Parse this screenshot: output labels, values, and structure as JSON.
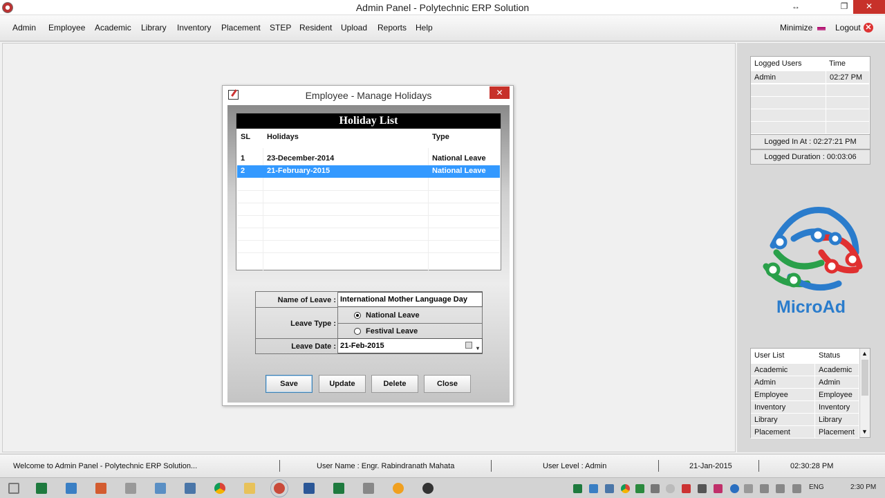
{
  "window": {
    "title": "Admin Panel - Polytechnic ERP Solution",
    "restore_glyph": "↔",
    "maximize_glyph": "❐",
    "close_glyph": "✕"
  },
  "menu": {
    "items": [
      "Admin",
      "Employee",
      "Academic",
      "Library",
      "Inventory",
      "Placement",
      "STEP",
      "Resident",
      "Upload",
      "Reports",
      "Help"
    ],
    "minimize": "Minimize",
    "logout": "Logout",
    "logout_glyph": "✕"
  },
  "logged_users": {
    "headers": [
      "Logged Users",
      "Time"
    ],
    "rows": [
      [
        "Admin",
        "02:27 PM"
      ]
    ],
    "logged_in_at": "Logged In At : 02:27:21 PM",
    "logged_duration": "Logged Duration : 00:03:06"
  },
  "logo": {
    "text": "MicroAd"
  },
  "user_list": {
    "headers": [
      "User List",
      "Status"
    ],
    "rows": [
      [
        "Academic",
        "Academic"
      ],
      [
        "Admin",
        "Admin"
      ],
      [
        "Employee",
        "Employee"
      ],
      [
        "Inventory",
        "Inventory"
      ],
      [
        "Library",
        "Library"
      ],
      [
        "Placement",
        "Placement"
      ]
    ],
    "scroll_up": "▲",
    "scroll_down": "▼"
  },
  "dialog": {
    "title": "Employee - Manage Holidays",
    "close_glyph": "✕",
    "holiday_list_title": "Holiday List",
    "columns": [
      "SL",
      "Holidays",
      "Type"
    ],
    "rows": [
      {
        "sl": "1",
        "holiday": "23-December-2014",
        "type": "National Leave"
      },
      {
        "sl": "2",
        "holiday": "21-February-2015",
        "type": "National Leave"
      }
    ],
    "selected_row": 2,
    "form": {
      "name_label": "Name of Leave :",
      "name_value": "International Mother Language Day",
      "type_label": "Leave Type :",
      "type_options": [
        "National Leave",
        "Festival Leave"
      ],
      "type_selected": "National Leave",
      "date_label": "Leave Date :",
      "date_value": "21-Feb-2015",
      "date_dropdown_glyph": "▾"
    },
    "buttons": {
      "save": "Save",
      "update": "Update",
      "delete": "Delete",
      "close": "Close"
    }
  },
  "statusbar": {
    "welcome": "Welcome to Admin Panel - Polytechnic ERP Solution...",
    "user_name": "User Name : Engr. Rabindranath Mahata",
    "user_level": "User Level : Admin",
    "date": "21-Jan-2015",
    "time": "02:30:28 PM"
  },
  "taskbar": {
    "language": "ENG",
    "clock": "2:30 PM"
  },
  "colors": {
    "selection": "#3399ff",
    "close_red": "#c7312a",
    "logo_blue": "#2a7ccc",
    "logo_red": "#e03030",
    "logo_green": "#2aa04a"
  }
}
